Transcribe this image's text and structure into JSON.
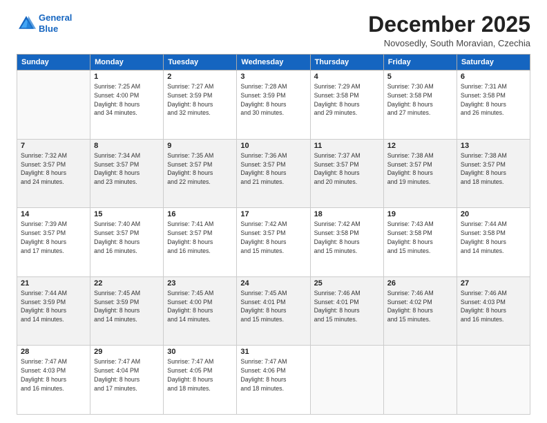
{
  "logo": {
    "line1": "General",
    "line2": "Blue"
  },
  "title": "December 2025",
  "location": "Novosedly, South Moravian, Czechia",
  "days_header": [
    "Sunday",
    "Monday",
    "Tuesday",
    "Wednesday",
    "Thursday",
    "Friday",
    "Saturday"
  ],
  "weeks": [
    [
      {
        "num": "",
        "content": ""
      },
      {
        "num": "1",
        "content": "Sunrise: 7:25 AM\nSunset: 4:00 PM\nDaylight: 8 hours\nand 34 minutes."
      },
      {
        "num": "2",
        "content": "Sunrise: 7:27 AM\nSunset: 3:59 PM\nDaylight: 8 hours\nand 32 minutes."
      },
      {
        "num": "3",
        "content": "Sunrise: 7:28 AM\nSunset: 3:59 PM\nDaylight: 8 hours\nand 30 minutes."
      },
      {
        "num": "4",
        "content": "Sunrise: 7:29 AM\nSunset: 3:58 PM\nDaylight: 8 hours\nand 29 minutes."
      },
      {
        "num": "5",
        "content": "Sunrise: 7:30 AM\nSunset: 3:58 PM\nDaylight: 8 hours\nand 27 minutes."
      },
      {
        "num": "6",
        "content": "Sunrise: 7:31 AM\nSunset: 3:58 PM\nDaylight: 8 hours\nand 26 minutes."
      }
    ],
    [
      {
        "num": "7",
        "content": "Sunrise: 7:32 AM\nSunset: 3:57 PM\nDaylight: 8 hours\nand 24 minutes."
      },
      {
        "num": "8",
        "content": "Sunrise: 7:34 AM\nSunset: 3:57 PM\nDaylight: 8 hours\nand 23 minutes."
      },
      {
        "num": "9",
        "content": "Sunrise: 7:35 AM\nSunset: 3:57 PM\nDaylight: 8 hours\nand 22 minutes."
      },
      {
        "num": "10",
        "content": "Sunrise: 7:36 AM\nSunset: 3:57 PM\nDaylight: 8 hours\nand 21 minutes."
      },
      {
        "num": "11",
        "content": "Sunrise: 7:37 AM\nSunset: 3:57 PM\nDaylight: 8 hours\nand 20 minutes."
      },
      {
        "num": "12",
        "content": "Sunrise: 7:38 AM\nSunset: 3:57 PM\nDaylight: 8 hours\nand 19 minutes."
      },
      {
        "num": "13",
        "content": "Sunrise: 7:38 AM\nSunset: 3:57 PM\nDaylight: 8 hours\nand 18 minutes."
      }
    ],
    [
      {
        "num": "14",
        "content": "Sunrise: 7:39 AM\nSunset: 3:57 PM\nDaylight: 8 hours\nand 17 minutes."
      },
      {
        "num": "15",
        "content": "Sunrise: 7:40 AM\nSunset: 3:57 PM\nDaylight: 8 hours\nand 16 minutes."
      },
      {
        "num": "16",
        "content": "Sunrise: 7:41 AM\nSunset: 3:57 PM\nDaylight: 8 hours\nand 16 minutes."
      },
      {
        "num": "17",
        "content": "Sunrise: 7:42 AM\nSunset: 3:57 PM\nDaylight: 8 hours\nand 15 minutes."
      },
      {
        "num": "18",
        "content": "Sunrise: 7:42 AM\nSunset: 3:58 PM\nDaylight: 8 hours\nand 15 minutes."
      },
      {
        "num": "19",
        "content": "Sunrise: 7:43 AM\nSunset: 3:58 PM\nDaylight: 8 hours\nand 15 minutes."
      },
      {
        "num": "20",
        "content": "Sunrise: 7:44 AM\nSunset: 3:58 PM\nDaylight: 8 hours\nand 14 minutes."
      }
    ],
    [
      {
        "num": "21",
        "content": "Sunrise: 7:44 AM\nSunset: 3:59 PM\nDaylight: 8 hours\nand 14 minutes."
      },
      {
        "num": "22",
        "content": "Sunrise: 7:45 AM\nSunset: 3:59 PM\nDaylight: 8 hours\nand 14 minutes."
      },
      {
        "num": "23",
        "content": "Sunrise: 7:45 AM\nSunset: 4:00 PM\nDaylight: 8 hours\nand 14 minutes."
      },
      {
        "num": "24",
        "content": "Sunrise: 7:45 AM\nSunset: 4:01 PM\nDaylight: 8 hours\nand 15 minutes."
      },
      {
        "num": "25",
        "content": "Sunrise: 7:46 AM\nSunset: 4:01 PM\nDaylight: 8 hours\nand 15 minutes."
      },
      {
        "num": "26",
        "content": "Sunrise: 7:46 AM\nSunset: 4:02 PM\nDaylight: 8 hours\nand 15 minutes."
      },
      {
        "num": "27",
        "content": "Sunrise: 7:46 AM\nSunset: 4:03 PM\nDaylight: 8 hours\nand 16 minutes."
      }
    ],
    [
      {
        "num": "28",
        "content": "Sunrise: 7:47 AM\nSunset: 4:03 PM\nDaylight: 8 hours\nand 16 minutes."
      },
      {
        "num": "29",
        "content": "Sunrise: 7:47 AM\nSunset: 4:04 PM\nDaylight: 8 hours\nand 17 minutes."
      },
      {
        "num": "30",
        "content": "Sunrise: 7:47 AM\nSunset: 4:05 PM\nDaylight: 8 hours\nand 18 minutes."
      },
      {
        "num": "31",
        "content": "Sunrise: 7:47 AM\nSunset: 4:06 PM\nDaylight: 8 hours\nand 18 minutes."
      },
      {
        "num": "",
        "content": ""
      },
      {
        "num": "",
        "content": ""
      },
      {
        "num": "",
        "content": ""
      }
    ]
  ]
}
